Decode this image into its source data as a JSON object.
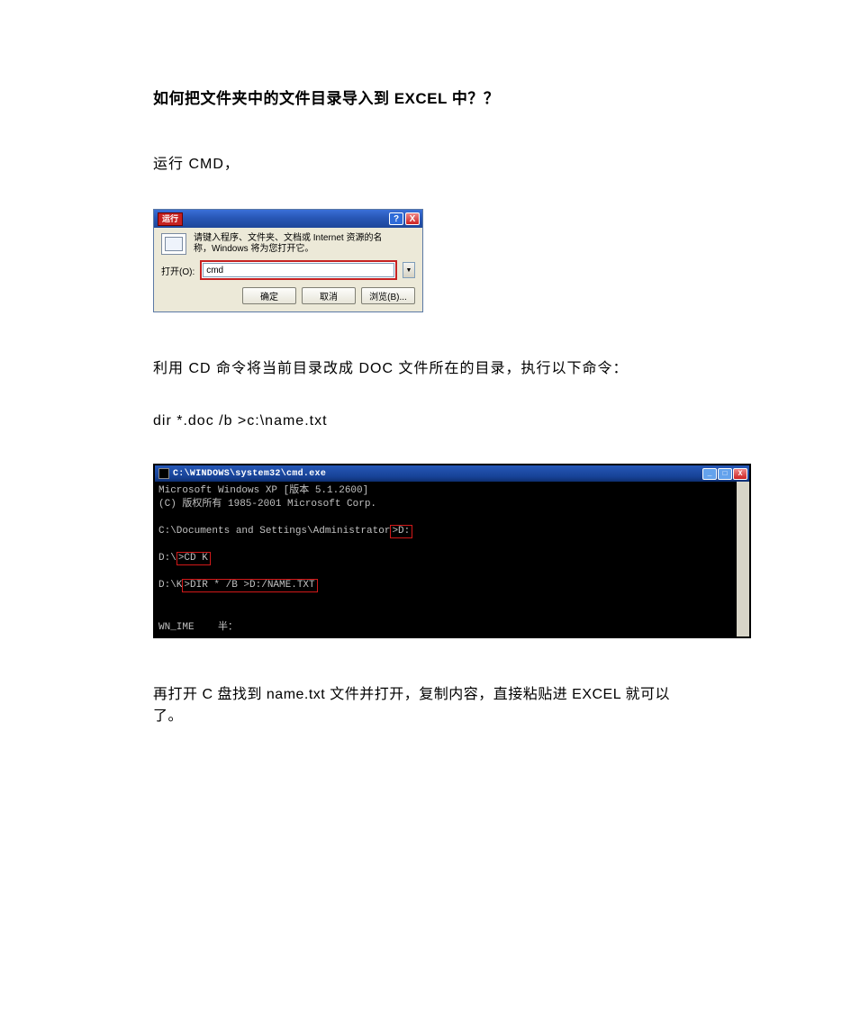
{
  "title": "如何把文件夹中的文件目录导入到 EXCEL  中？？",
  "paragraph1": "运行 CMD，",
  "runDialog": {
    "titlebarLabel": "运行",
    "helpBtn": "?",
    "closeBtn": "X",
    "descLine1": "请键入程序、文件夹、文档或 Internet 资源的名",
    "descLine2": "称，Windows 将为您打开它。",
    "openLabel": "打开(O):",
    "inputValue": "cmd",
    "okBtn": "确定",
    "cancelBtn": "取消",
    "browseBtn": "浏览(B)..."
  },
  "paragraph2": "利用 CD 命令将当前目录改成 DOC 文件所在的目录，执行以下命令：",
  "codeLine": "dir  *.doc  /b  >c:\\name.txt",
  "cmd": {
    "title": "C:\\WINDOWS\\system32\\cmd.exe",
    "line1": "Microsoft Windows XP [版本 5.1.2600]",
    "line2": "(C) 版权所有 1985-2001 Microsoft Corp.",
    "line3_prefix": "C:\\Documents and Settings\\Administrator",
    "line3_hl": ">D:",
    "line4_prefix": "D:\\",
    "line4_hl": ">CD K",
    "line5_prefix": "D:\\K",
    "line5_hl": ">DIR * /B >D:/NAME.TXT",
    "status": "WN_IME    半："
  },
  "paragraph3": "再打开 C 盘找到 name.txt 文件并打开，复制内容，直接粘贴进 EXCEL  就可以了。"
}
